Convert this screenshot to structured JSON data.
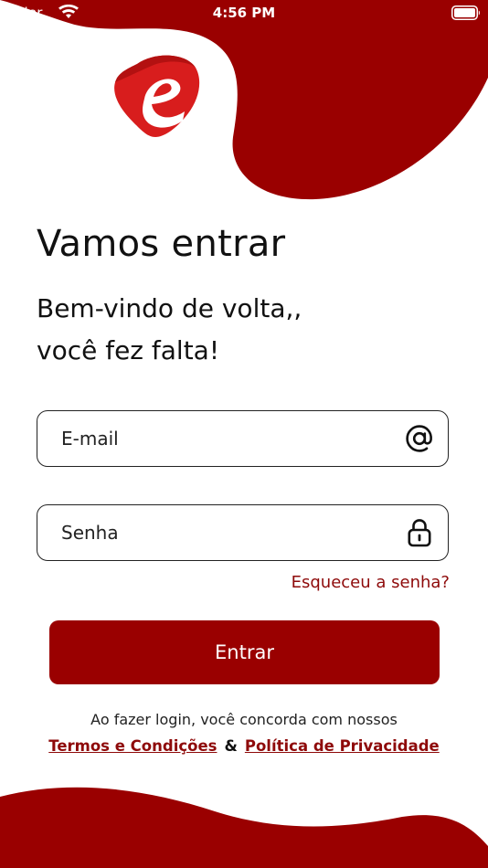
{
  "status_bar": {
    "carrier": "rrier",
    "time": "4:56 PM"
  },
  "icons": {
    "wifi": "wifi-icon",
    "battery": "battery-icon",
    "email": "at-sign-icon",
    "password": "lock-icon",
    "logo": "brand-logo-e"
  },
  "colors": {
    "brand": "#9a0000",
    "link": "#8e0a0a",
    "text": "#111111",
    "background": "#ffffff"
  },
  "login": {
    "title": "Vamos entrar",
    "subtitle_line1": "Bem-vindo de volta,,",
    "subtitle_line2": "você fez falta!",
    "email_placeholder": "E-mail",
    "email_value": "",
    "password_placeholder": "Senha",
    "password_value": "",
    "forgot_password": "Esqueceu a senha?",
    "submit_label": "Entrar",
    "terms_text": "Ao fazer login, você concorda com nossos",
    "terms_link": "Termos e Condições",
    "ampersand": "&",
    "privacy_link": "Política de Privacidade"
  }
}
